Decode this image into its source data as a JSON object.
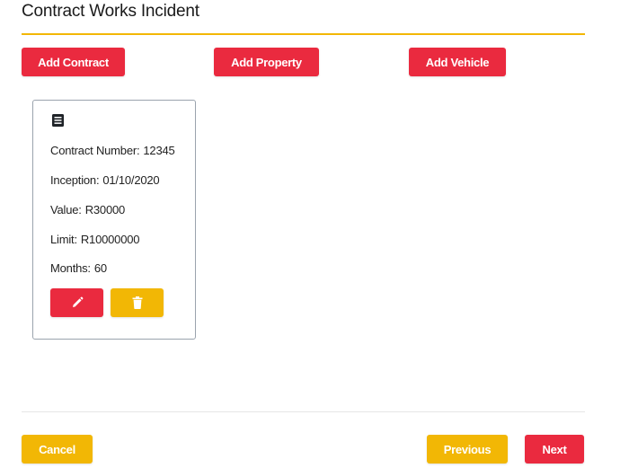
{
  "page": {
    "title": "Contract Works Incident"
  },
  "toolbar": {
    "add_contract_label": "Add Contract",
    "add_property_label": "Add Property",
    "add_vehicle_label": "Add Vehicle"
  },
  "contract_card": {
    "icon": "document-list-icon",
    "fields": [
      {
        "label": "Contract Number:",
        "value": "12345"
      },
      {
        "label": "Inception:",
        "value": "01/10/2020"
      },
      {
        "label": "Value:",
        "value": "R30000"
      },
      {
        "label": "Limit:",
        "value": "R10000000"
      },
      {
        "label": "Months:",
        "value": "60"
      }
    ],
    "edit_icon": "pencil-icon",
    "delete_icon": "trash-icon"
  },
  "footer": {
    "cancel_label": "Cancel",
    "previous_label": "Previous",
    "next_label": "Next"
  },
  "colors": {
    "primary_red": "#ea2a3f",
    "accent_yellow": "#f2b705",
    "card_border": "#9aa3ad"
  }
}
